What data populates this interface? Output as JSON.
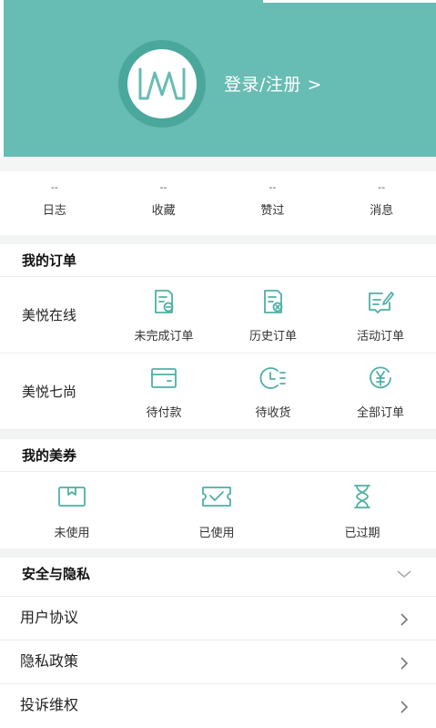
{
  "header": {
    "login_label": "登录/注册 >"
  },
  "stats": [
    {
      "value": "--",
      "label": "日志"
    },
    {
      "value": "--",
      "label": "收藏"
    },
    {
      "value": "--",
      "label": "赞过"
    },
    {
      "value": "--",
      "label": "消息"
    }
  ],
  "orders": {
    "title": "我的订单",
    "rows": [
      {
        "label": "美悦在线",
        "items": [
          {
            "label": "未完成订单",
            "icon": "document-minus-icon"
          },
          {
            "label": "历史订单",
            "icon": "document-close-icon"
          },
          {
            "label": "活动订单",
            "icon": "edit-note-icon"
          }
        ]
      },
      {
        "label": "美悦七尚",
        "items": [
          {
            "label": "待付款",
            "icon": "wallet-icon"
          },
          {
            "label": "待收货",
            "icon": "clock-list-icon"
          },
          {
            "label": "全部订单",
            "icon": "yen-circle-icon"
          }
        ]
      }
    ]
  },
  "coupons": {
    "title": "我的美券",
    "items": [
      {
        "label": "未使用",
        "icon": "coupon-box-icon"
      },
      {
        "label": "已使用",
        "icon": "coupon-check-icon"
      },
      {
        "label": "已过期",
        "icon": "hourglass-icon"
      }
    ]
  },
  "privacy": {
    "title": "安全与隐私",
    "items": [
      {
        "label": "用户协议"
      },
      {
        "label": "隐私政策"
      },
      {
        "label": "投诉维权"
      }
    ]
  },
  "colors": {
    "brand_teal": "#67bcb3",
    "icon_teal": "#4fb0a4"
  }
}
